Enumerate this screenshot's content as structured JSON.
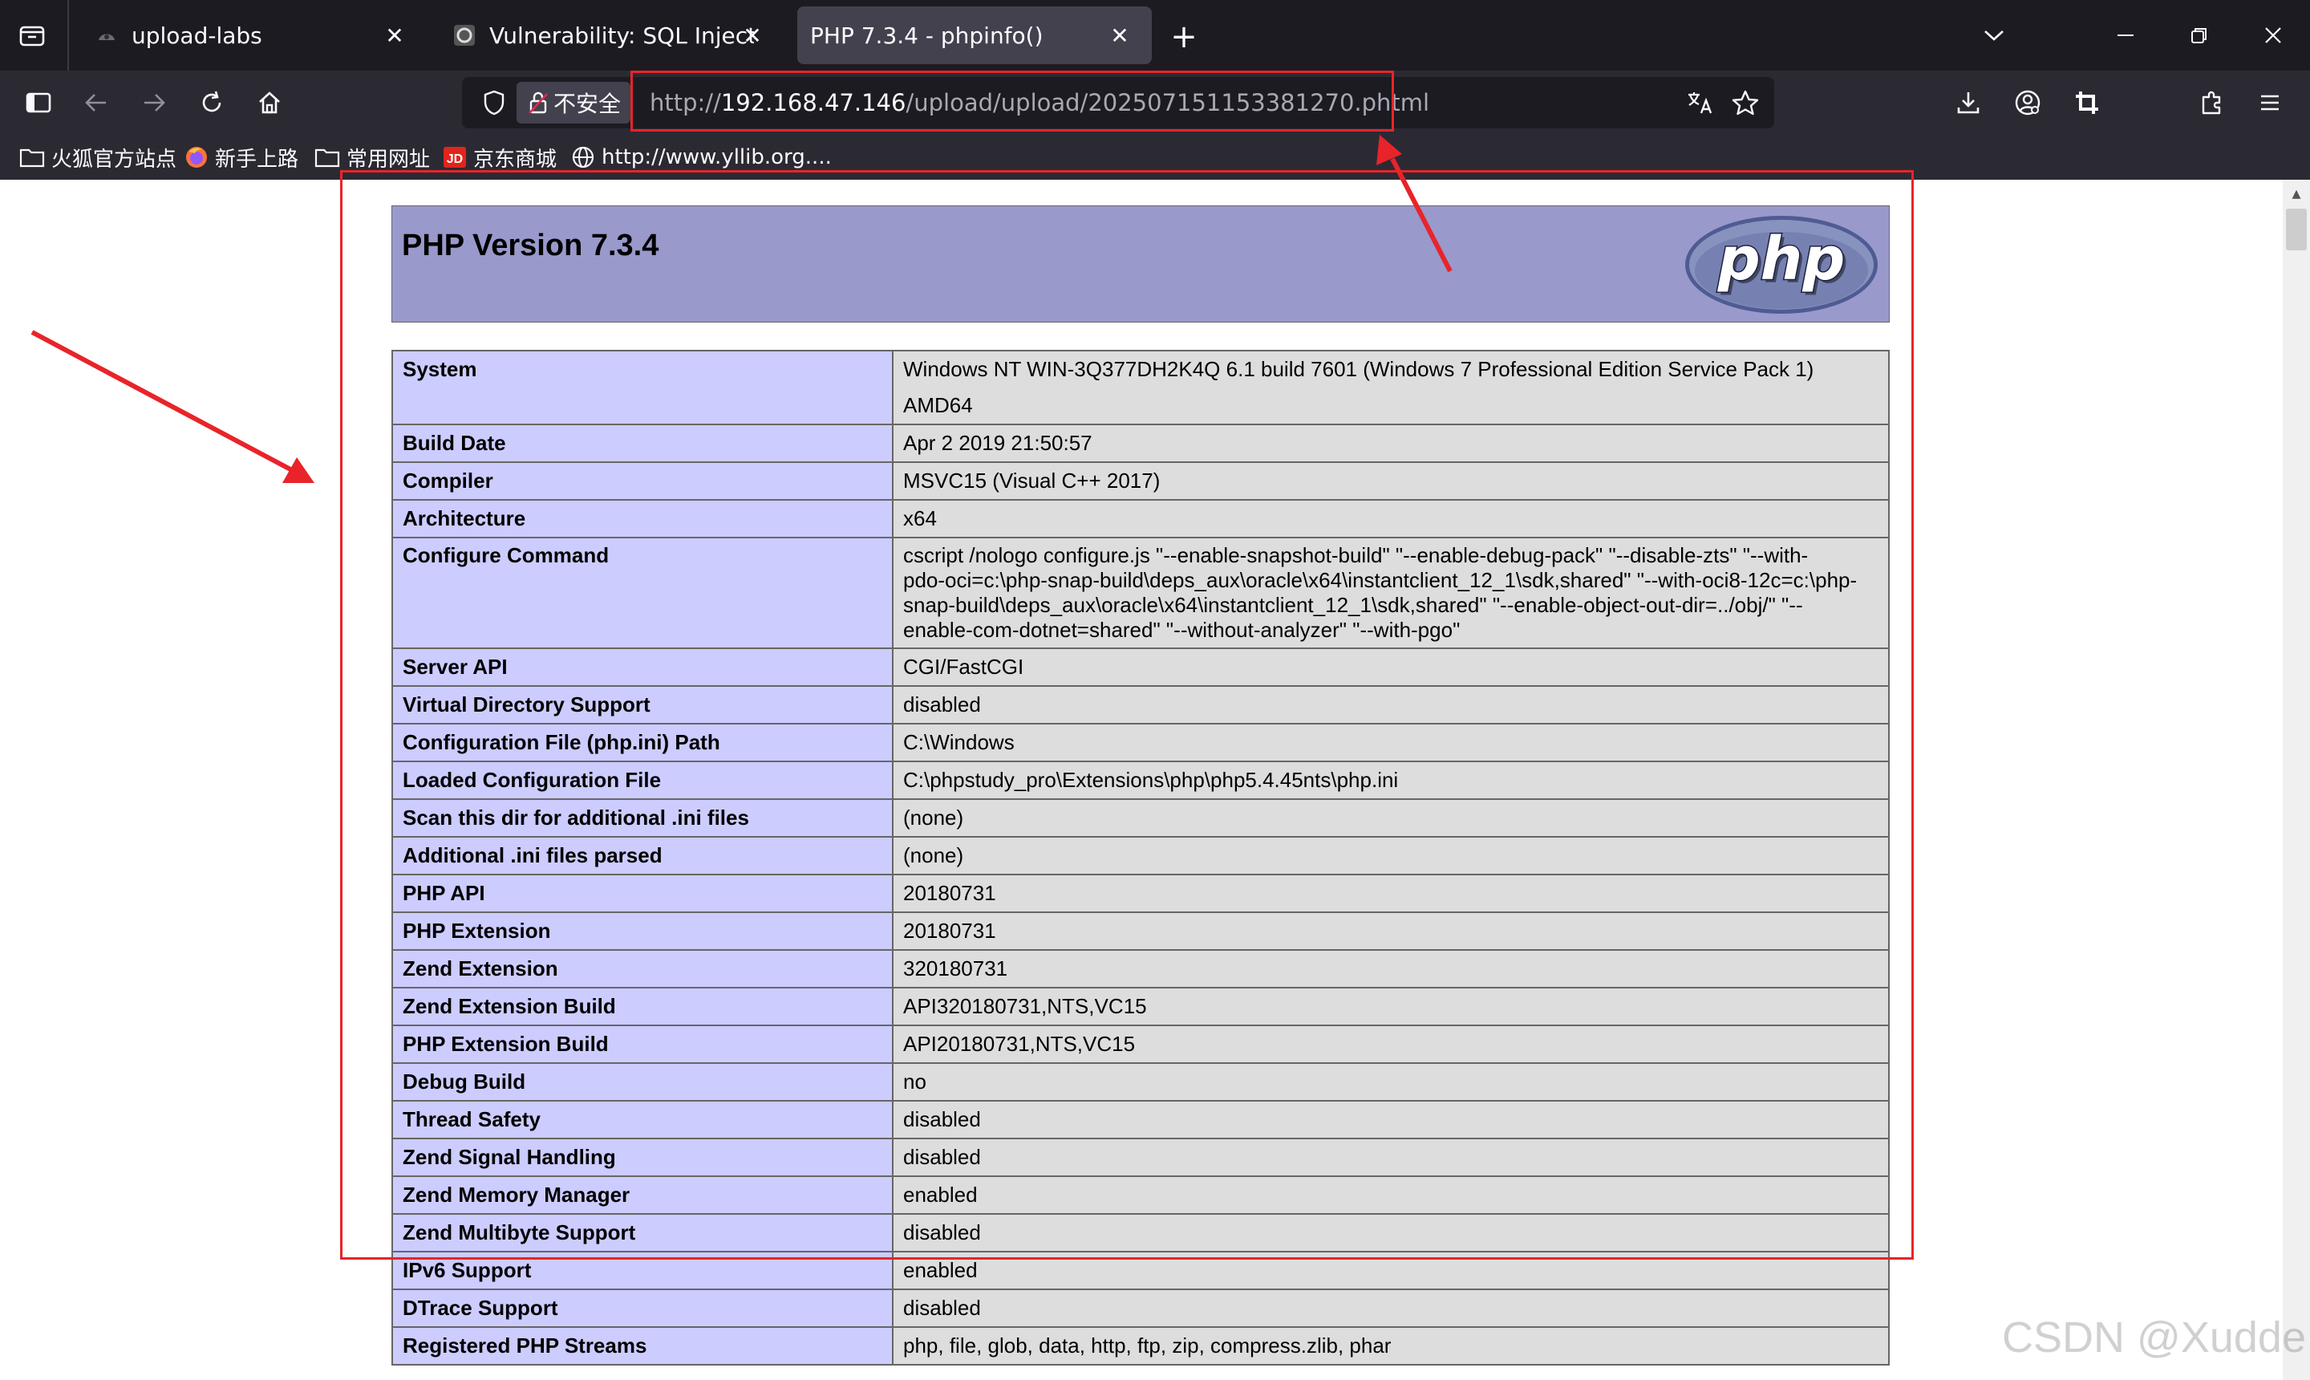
{
  "browser": {
    "tabs": [
      {
        "title": "upload-labs",
        "active": false
      },
      {
        "title": "Vulnerability: SQL Injection ::",
        "active": false
      },
      {
        "title": "PHP 7.3.4 - phpinfo()",
        "active": true
      }
    ],
    "security_label": "不安全",
    "url": {
      "scheme": "http://",
      "host": "192.168.47.146",
      "path": "/upload/upload/202507151153381270.phtml"
    },
    "bookmarks": [
      {
        "label": "火狐官方站点",
        "icon": "folder-icon"
      },
      {
        "label": "新手上路",
        "icon": "firefox-icon"
      },
      {
        "label": "常用网址",
        "icon": "folder-icon"
      },
      {
        "label": "京东商城",
        "icon": "jd-icon"
      },
      {
        "label": "http://www.yllib.org....",
        "icon": "globe-icon"
      }
    ]
  },
  "php": {
    "version_title": "PHP Version 7.3.4",
    "logo_text": "php",
    "rows": [
      {
        "key": "System",
        "value": "Windows NT WIN-3Q377DH2K4Q 6.1 build 7601 (Windows 7 Professional Edition Service Pack 1) AMD64"
      },
      {
        "key": "Build Date",
        "value": "Apr 2 2019 21:50:57"
      },
      {
        "key": "Compiler",
        "value": "MSVC15 (Visual C++ 2017)"
      },
      {
        "key": "Architecture",
        "value": "x64"
      },
      {
        "key": "Configure Command",
        "value_lines": [
          "cscript /nologo configure.js \"--enable-snapshot-build\" \"--enable-debug-pack\" \"--disable-zts\" \"--with-",
          "pdo-oci=c:\\php-snap-build\\deps_aux\\oracle\\x64\\instantclient_12_1\\sdk,shared\" \"--with-oci8-12c=c:\\php-",
          "snap-build\\deps_aux\\oracle\\x64\\instantclient_12_1\\sdk,shared\" \"--enable-object-out-dir=../obj/\" \"--",
          "enable-com-dotnet=shared\" \"--without-analyzer\" \"--with-pgo\""
        ]
      },
      {
        "key": "Server API",
        "value": "CGI/FastCGI"
      },
      {
        "key": "Virtual Directory Support",
        "value": "disabled"
      },
      {
        "key": "Configuration File (php.ini) Path",
        "value": "C:\\Windows"
      },
      {
        "key": "Loaded Configuration File",
        "value": "C:\\phpstudy_pro\\Extensions\\php\\php5.4.45nts\\php.ini"
      },
      {
        "key": "Scan this dir for additional .ini files",
        "value": "(none)"
      },
      {
        "key": "Additional .ini files parsed",
        "value": "(none)"
      },
      {
        "key": "PHP API",
        "value": "20180731"
      },
      {
        "key": "PHP Extension",
        "value": "20180731"
      },
      {
        "key": "Zend Extension",
        "value": "320180731"
      },
      {
        "key": "Zend Extension Build",
        "value": "API320180731,NTS,VC15"
      },
      {
        "key": "PHP Extension Build",
        "value": "API20180731,NTS,VC15"
      },
      {
        "key": "Debug Build",
        "value": "no"
      },
      {
        "key": "Thread Safety",
        "value": "disabled"
      },
      {
        "key": "Zend Signal Handling",
        "value": "disabled"
      },
      {
        "key": "Zend Memory Manager",
        "value": "enabled"
      },
      {
        "key": "Zend Multibyte Support",
        "value": "disabled"
      },
      {
        "key": "IPv6 Support",
        "value": "enabled"
      },
      {
        "key": "DTrace Support",
        "value": "disabled"
      },
      {
        "key": "Registered PHP Streams",
        "value": "php, file, glob, data, http, ftp, zip, compress.zlib, phar"
      }
    ]
  },
  "watermark": "CSDN @Xudde.",
  "colors": {
    "annotation_red": "#e8242a",
    "php_header": "#9999cc",
    "php_key_cell": "#ccccff",
    "php_value_cell": "#dddddd"
  }
}
